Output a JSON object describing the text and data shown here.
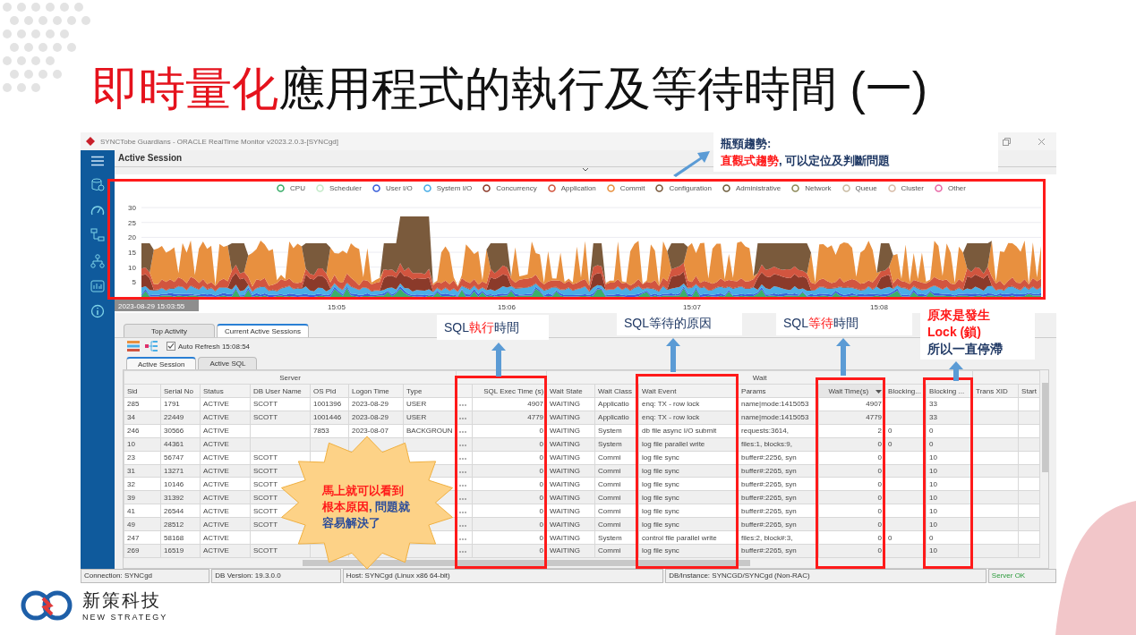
{
  "slide": {
    "title_highlight": "即時量化",
    "title_rest": "應用程式的執行及等待時間 (一)"
  },
  "window": {
    "title": "SYNCTobe Guardians - ORACLE RealTime Monitor v2023.2.0.3-[SYNCgd]",
    "page_title": "Active Session"
  },
  "chart": {
    "legend": [
      {
        "name": "CPU",
        "color": "#3cae6b"
      },
      {
        "name": "Scheduler",
        "color": "#c4ebc9"
      },
      {
        "name": "User I/O",
        "color": "#3a5fd9"
      },
      {
        "name": "System I/O",
        "color": "#4aaee6"
      },
      {
        "name": "Concurrency",
        "color": "#8b3a2a"
      },
      {
        "name": "Application",
        "color": "#d2553f"
      },
      {
        "name": "Commit",
        "color": "#e8903f"
      },
      {
        "name": "Configuration",
        "color": "#7a5a3c"
      },
      {
        "name": "Administrative",
        "color": "#6e5e3e"
      },
      {
        "name": "Network",
        "color": "#8d8a5a"
      },
      {
        "name": "Queue",
        "color": "#c9bba3"
      },
      {
        "name": "Cluster",
        "color": "#d8bca8"
      },
      {
        "name": "Other",
        "color": "#e86aa8"
      }
    ],
    "yticks": [
      "30",
      "25",
      "20",
      "15",
      "10",
      "5"
    ],
    "xlabels": [
      "15:05",
      "15:06",
      "15:07",
      "15:08"
    ],
    "start_time": "2023-08-29 15:03:55"
  },
  "tabs": [
    {
      "label": "Top Activity",
      "selected": false
    },
    {
      "label": "Current Active Sessions",
      "selected": true
    }
  ],
  "auto_refresh": {
    "label": "Auto Refresh 15:08:54",
    "checked": true
  },
  "subtabs": [
    {
      "label": "Active Session",
      "selected": true
    },
    {
      "label": "Active SQL",
      "selected": false
    }
  ],
  "table": {
    "groups": [
      {
        "label": "Server",
        "columns": [
          {
            "label": "Sid",
            "kind": "text",
            "sorted": false
          },
          {
            "label": "Serial No",
            "kind": "text",
            "sorted": false
          },
          {
            "label": "Status",
            "kind": "text",
            "sorted": false
          },
          {
            "label": "DB User Name",
            "kind": "text",
            "sorted": false
          },
          {
            "label": "OS Pid",
            "kind": "text",
            "sorted": false
          },
          {
            "label": "Logon Time",
            "kind": "text",
            "sorted": false
          },
          {
            "label": "Type",
            "kind": "text",
            "sorted": false
          }
        ]
      },
      {
        "columns": [
          {
            "kind": "dots",
            "sorted": false
          },
          {
            "label": "SQL Exec Time (s)",
            "kind": "number",
            "sorted": false
          }
        ]
      },
      {
        "label": "Wait",
        "columns": [
          {
            "label": "Wait State",
            "kind": "text",
            "sorted": false
          },
          {
            "label": "Wait Class",
            "kind": "text",
            "sorted": false
          },
          {
            "label": "Wait Event",
            "kind": "text",
            "sorted": false
          },
          {
            "label": "Params",
            "kind": "text",
            "sorted": false
          },
          {
            "label": "Wait Time(s)",
            "kind": "number",
            "sorted": true
          },
          {
            "label": "Blocking...",
            "kind": "text",
            "sorted": false
          },
          {
            "label": "Blocking ...",
            "kind": "text",
            "sorted": false
          }
        ]
      },
      {
        "columns": [
          {
            "label": "Trans XID",
            "kind": "text",
            "sorted": false
          },
          {
            "label": "Start",
            "kind": "text",
            "sorted": false
          }
        ]
      }
    ],
    "rows": [
      {
        "cells": [
          "285",
          "1791",
          "ACTIVE",
          "SCOTT",
          "1001396",
          "2023-08-29",
          "USER",
          null,
          "4907",
          "WAITING",
          "Applicatio",
          "enq: TX - row lock",
          "name|mode:1415053",
          "4907",
          null,
          "33",
          null,
          null
        ]
      },
      {
        "cells": [
          "34",
          "22449",
          "ACTIVE",
          "SCOTT",
          "1001446",
          "2023-08-29",
          "USER",
          null,
          "4779",
          "WAITING",
          "Applicatio",
          "enq: TX - row lock",
          "name|mode:1415053",
          "4779",
          null,
          "33",
          null,
          null
        ]
      },
      {
        "cells": [
          "246",
          "30566",
          "ACTIVE",
          null,
          "7853",
          "2023-08-07",
          "BACKGROUN",
          null,
          "0",
          "WAITING",
          "System",
          "db file async I/O submit",
          "requests:3614,",
          "2",
          "0",
          "0",
          null,
          null
        ]
      },
      {
        "cells": [
          "10",
          "44361",
          "ACTIVE",
          null,
          null,
          null,
          null,
          null,
          "0",
          "WAITING",
          "System",
          "log file parallel write",
          "files:1, blocks:9,",
          "0",
          "0",
          "0",
          null,
          null
        ]
      },
      {
        "cells": [
          "23",
          "56747",
          "ACTIVE",
          "SCOTT",
          null,
          null,
          null,
          null,
          "0",
          "WAITING",
          "Commi",
          "log file sync",
          "buffer#:2256, syn",
          "0",
          null,
          "10",
          null,
          null
        ]
      },
      {
        "cells": [
          "31",
          "13271",
          "ACTIVE",
          "SCOTT",
          null,
          null,
          null,
          null,
          "0",
          "WAITING",
          "Commi",
          "log file sync",
          "buffer#:2265, syn",
          "0",
          null,
          "10",
          null,
          null
        ]
      },
      {
        "cells": [
          "32",
          "10146",
          "ACTIVE",
          "SCOTT",
          null,
          null,
          null,
          null,
          "0",
          "WAITING",
          "Commi",
          "log file sync",
          "buffer#:2265, syn",
          "0",
          null,
          "10",
          null,
          null
        ]
      },
      {
        "cells": [
          "39",
          "31392",
          "ACTIVE",
          "SCOTT",
          null,
          null,
          null,
          null,
          "0",
          "WAITING",
          "Commi",
          "log file sync",
          "buffer#:2265, syn",
          "0",
          null,
          "10",
          null,
          null
        ]
      },
      {
        "cells": [
          "41",
          "26544",
          "ACTIVE",
          "SCOTT",
          null,
          null,
          null,
          null,
          "0",
          "WAITING",
          "Commi",
          "log file sync",
          "buffer#:2265, syn",
          "0",
          null,
          "10",
          null,
          null
        ]
      },
      {
        "cells": [
          "49",
          "28512",
          "ACTIVE",
          "SCOTT",
          null,
          null,
          null,
          null,
          "0",
          "WAITING",
          "Commi",
          "log file sync",
          "buffer#:2265, syn",
          "0",
          null,
          "10",
          null,
          null
        ]
      },
      {
        "cells": [
          "247",
          "58168",
          "ACTIVE",
          null,
          null,
          null,
          null,
          null,
          "0",
          "WAITING",
          "System",
          "control file parallel write",
          "files:2, block#:3,",
          "0",
          "0",
          "0",
          null,
          null
        ]
      },
      {
        "cells": [
          "269",
          "16519",
          "ACTIVE",
          "SCOTT",
          null,
          null,
          null,
          null,
          "0",
          "WAITING",
          "Commi",
          "log file sync",
          "buffer#:2265, syn",
          "0",
          null,
          "10",
          null,
          null
        ]
      }
    ]
  },
  "status_bar": [
    {
      "text": "Connection: SYNCgd",
      "kind": "info"
    },
    {
      "text": "DB Version: 19.3.0.0",
      "kind": "info"
    },
    {
      "text": "Host: SYNCgd (Linux x86 64-bit)",
      "kind": "info"
    },
    {
      "text": "DB/Instance: SYNCGD/SYNCgd (Non-RAC)",
      "kind": "info"
    },
    {
      "text": "Server OK",
      "kind": "ok"
    }
  ],
  "callouts": [
    {
      "lines": [
        [
          {
            "text": "瓶頸趨勢:",
            "highlight": false
          }
        ],
        [
          {
            "text": "直觀式趨勢",
            "highlight": true
          },
          {
            "text": ", 可以定位及判斷問題",
            "highlight": false
          }
        ]
      ]
    },
    {
      "lines": [
        [
          {
            "text": "SQL",
            "highlight": false
          },
          {
            "text": "執行",
            "highlight": true
          },
          {
            "text": "時間",
            "highlight": false
          }
        ]
      ]
    },
    {
      "lines": [
        [
          {
            "text": "SQL等待的原因",
            "highlight": false
          }
        ]
      ]
    },
    {
      "lines": [
        [
          {
            "text": "SQL",
            "highlight": false
          },
          {
            "text": "等待",
            "highlight": true
          },
          {
            "text": "時間",
            "highlight": false
          }
        ]
      ]
    },
    {
      "lines": [
        [
          {
            "text": "原來是發生",
            "highlight": true
          }
        ],
        [
          {
            "text": "Lock (鎖)",
            "highlight": true
          }
        ],
        [
          {
            "text": "所以一直停滯",
            "highlight": false
          }
        ]
      ]
    }
  ],
  "burst": {
    "lines": [
      [
        {
          "text": "馬上就可以看到",
          "highlight": true
        }
      ],
      [
        {
          "text": "根本原因",
          "highlight": true
        },
        {
          "text": ", 問題就",
          "highlight": false
        }
      ],
      [
        {
          "text": "容易解決了",
          "highlight": false
        }
      ]
    ]
  },
  "brand": {
    "name": "新策科技",
    "tagline": "NEW STRATEGY"
  }
}
